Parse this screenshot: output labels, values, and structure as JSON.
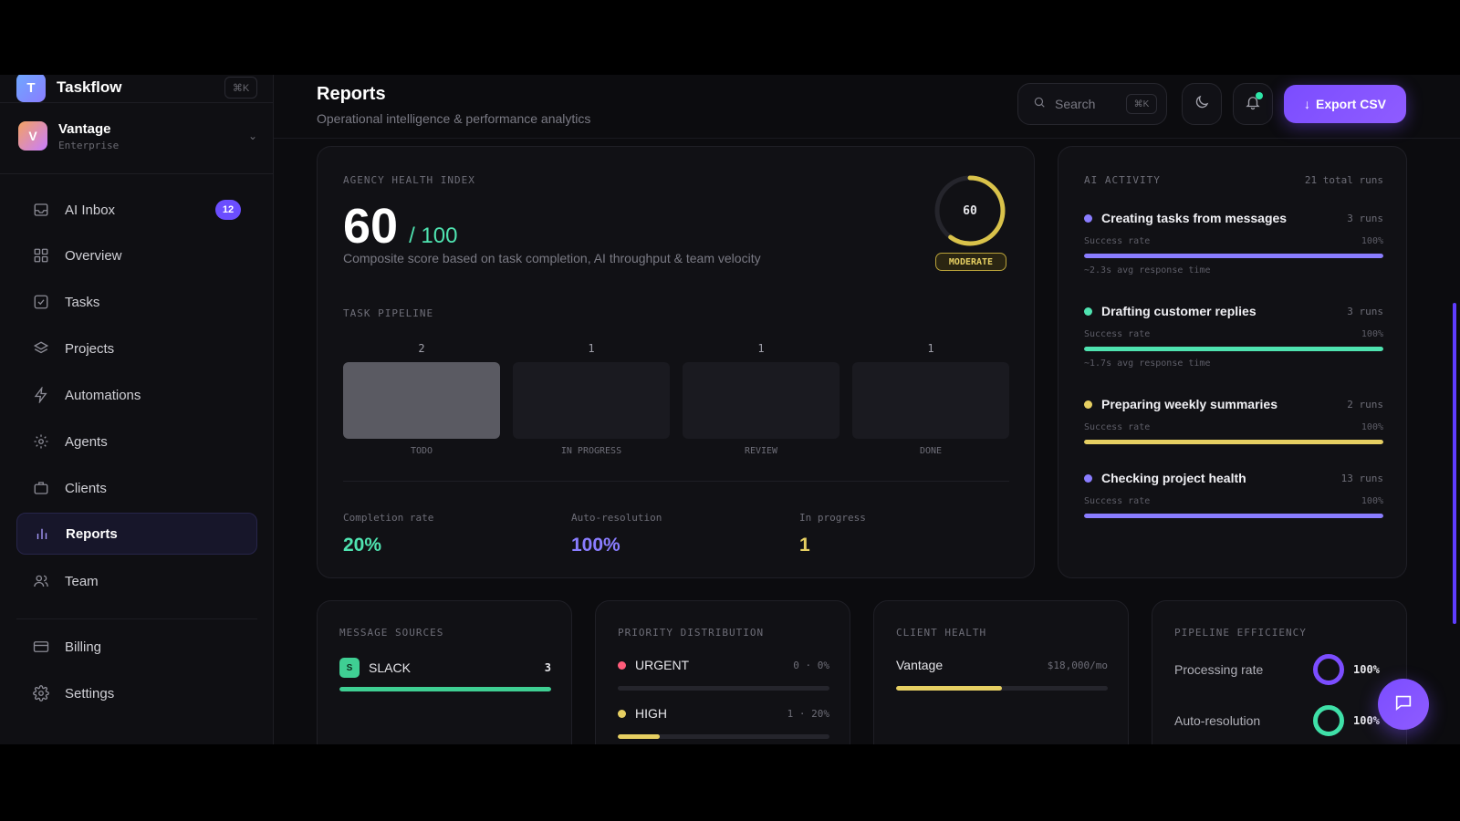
{
  "brand": {
    "logo_letter": "T",
    "name": "Taskflow",
    "shortcut": "⌘K"
  },
  "workspace": {
    "avatar_letter": "V",
    "name": "Vantage",
    "plan": "Enterprise"
  },
  "sidebar": {
    "items": [
      {
        "label": "AI Inbox",
        "icon": "inbox-icon",
        "badge": "12"
      },
      {
        "label": "Overview",
        "icon": "grid-icon"
      },
      {
        "label": "Tasks",
        "icon": "checkbox-icon"
      },
      {
        "label": "Projects",
        "icon": "layers-icon"
      },
      {
        "label": "Automations",
        "icon": "bolt-icon"
      },
      {
        "label": "Agents",
        "icon": "gear-icon"
      },
      {
        "label": "Clients",
        "icon": "briefcase-icon"
      },
      {
        "label": "Reports",
        "icon": "bar-chart-icon",
        "active": true
      },
      {
        "label": "Team",
        "icon": "users-icon"
      }
    ],
    "bottom": [
      {
        "label": "Billing",
        "icon": "credit-card-icon"
      },
      {
        "label": "Settings",
        "icon": "settings-icon"
      }
    ]
  },
  "header": {
    "title": "Reports",
    "subtitle": "Operational intelligence & performance analytics",
    "search_placeholder": "Search",
    "search_shortcut": "⌘K",
    "export_label": "Export CSV"
  },
  "health": {
    "kicker": "AGENCY HEALTH INDEX",
    "score": "60",
    "score_max": "/ 100",
    "score_value": 60,
    "description": "Composite score based on task completion, AI throughput & team velocity",
    "gauge_label": "60",
    "status": "MODERATE",
    "pipeline_kicker": "TASK PIPELINE",
    "pipeline": [
      {
        "count": "2",
        "name": "TODO"
      },
      {
        "count": "1",
        "name": "IN PROGRESS"
      },
      {
        "count": "1",
        "name": "REVIEW"
      },
      {
        "count": "1",
        "name": "DONE"
      }
    ],
    "stats": [
      {
        "label": "Completion rate",
        "value": "20%",
        "color": "#4fe3b0"
      },
      {
        "label": "Auto-resolution",
        "value": "100%",
        "color": "#8a7dff"
      },
      {
        "label": "In progress",
        "value": "1",
        "color": "#e6cf62"
      }
    ]
  },
  "ai_activity": {
    "kicker": "AI ACTIVITY",
    "total": "21 total runs",
    "items": [
      {
        "name": "Creating tasks from messages",
        "runs": "3 runs",
        "sr_label": "Success rate",
        "sr_value": "100%",
        "rate": 1.0,
        "note": "~2.3s avg response time",
        "color": "#8a7dff"
      },
      {
        "name": "Drafting customer replies",
        "runs": "3 runs",
        "sr_label": "Success rate",
        "sr_value": "100%",
        "rate": 1.0,
        "note": "~1.7s avg response time",
        "color": "#4fe3b0"
      },
      {
        "name": "Preparing weekly summaries",
        "runs": "2 runs",
        "sr_label": "Success rate",
        "sr_value": "100%",
        "rate": 1.0,
        "note": "",
        "color": "#e6cf62"
      },
      {
        "name": "Checking project health",
        "runs": "13 runs",
        "sr_label": "Success rate",
        "sr_value": "100%",
        "rate": 1.0,
        "note": "",
        "color": "#8a7dff"
      }
    ]
  },
  "message_sources": {
    "kicker": "MESSAGE SOURCES",
    "items": [
      {
        "icon_letter": "S",
        "name": "SLACK",
        "count": "3",
        "share": 1.0,
        "color": "#3fcf93"
      }
    ]
  },
  "priority": {
    "kicker": "PRIORITY DISTRIBUTION",
    "items": [
      {
        "name": "URGENT",
        "value": "0 · 0%",
        "share": 0.0,
        "color": "#ff5c7a"
      },
      {
        "name": "HIGH",
        "value": "1 · 20%",
        "share": 0.2,
        "color": "#e6cf62"
      }
    ]
  },
  "client_health": {
    "kicker": "CLIENT HEALTH",
    "items": [
      {
        "name": "Vantage",
        "value": "$18,000/mo",
        "share": 0.5,
        "color": "#e6cf62"
      }
    ]
  },
  "efficiency": {
    "kicker": "PIPELINE EFFICIENCY",
    "items": [
      {
        "label": "Processing rate",
        "value": "100%",
        "color": "#7b4dff"
      },
      {
        "label": "Auto-resolution",
        "value": "100%",
        "color": "#3fe0a8"
      }
    ]
  }
}
